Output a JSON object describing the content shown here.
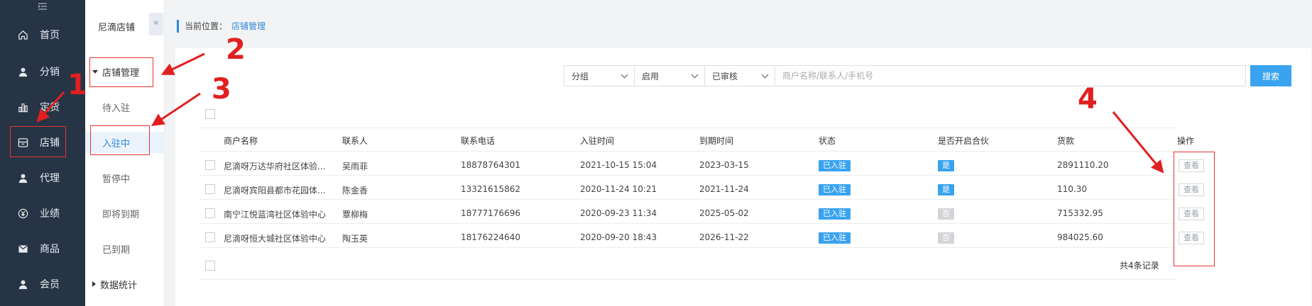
{
  "sidebar": {
    "toggle_icon": "menu-collapse-icon",
    "items": [
      {
        "label": "首页",
        "icon": "home-icon"
      },
      {
        "label": "分销",
        "icon": "user-icon"
      },
      {
        "label": "定货",
        "icon": "bar-chart-icon"
      },
      {
        "label": "店铺",
        "icon": "store-icon"
      },
      {
        "label": "代理",
        "icon": "user-icon"
      },
      {
        "label": "业绩",
        "icon": "yen-icon"
      },
      {
        "label": "商品",
        "icon": "mail-icon"
      },
      {
        "label": "会员",
        "icon": "user-icon"
      }
    ]
  },
  "subbar": {
    "title": "尼滴店铺",
    "group_store": "店铺管理",
    "items": [
      "待入驻",
      "入驻中",
      "暂停中",
      "即将到期",
      "已到期"
    ],
    "group_stats": "数据统计",
    "collapse_glyph": "«"
  },
  "breadcrumb": {
    "label": "当前位置：",
    "current": "店铺管理"
  },
  "filters": {
    "group": "分组",
    "enable": "启用",
    "audit": "已审核",
    "search_placeholder": "商户名称/联系人/手机号",
    "search_button": "搜索"
  },
  "table": {
    "headers": [
      "商户名称",
      "联系人",
      "联系电话",
      "入驻时间",
      "到期时间",
      "状态",
      "是否开启合伙",
      "货款",
      "操作"
    ],
    "rows": [
      {
        "name": "尼滴呀万达华府社区体验...",
        "contact": "吴雨菲",
        "phone": "18878764301",
        "start": "2021-10-15 15:04",
        "end": "2023-03-15",
        "status": "已入驻",
        "partner": "是",
        "amount": "2891110.20",
        "action": "查看"
      },
      {
        "name": "尼滴呀宾阳县都市花园体...",
        "contact": "陈金香",
        "phone": "13321615862",
        "start": "2020-11-24 10:21",
        "end": "2021-11-24",
        "status": "已入驻",
        "partner": "是",
        "amount": "110.30",
        "action": "查看"
      },
      {
        "name": "南宁江悦蓝湾社区体验中心",
        "contact": "覃柳梅",
        "phone": "18777176696",
        "start": "2020-09-23 11:34",
        "end": "2025-05-02",
        "status": "已入驻",
        "partner": "否",
        "amount": "715332.95",
        "action": "查看"
      },
      {
        "name": "尼滴呀恒大城社区体验中心",
        "contact": "陶玉英",
        "phone": "18176224640",
        "start": "2020-09-20 18:43",
        "end": "2026-11-22",
        "status": "已入驻",
        "partner": "否",
        "amount": "984025.60",
        "action": "查看"
      }
    ],
    "total": "共4条记录"
  },
  "annotations": {
    "n1": "1",
    "n2": "2",
    "n3": "3",
    "n4": "4",
    "color": "#e02020"
  },
  "colors": {
    "sidebar_bg": "#263445",
    "accent": "#3aa3ef",
    "link": "#2f89d8"
  }
}
